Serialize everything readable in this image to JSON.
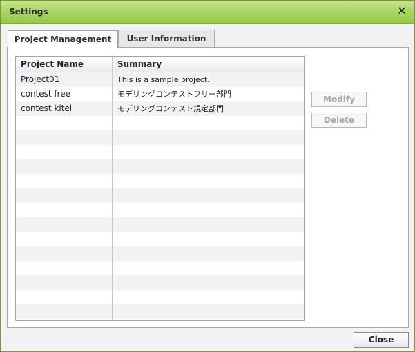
{
  "window": {
    "title": "Settings",
    "close_icon": "close-icon"
  },
  "tabs": [
    {
      "label": "Project Management",
      "active": true
    },
    {
      "label": "User Information",
      "active": false
    }
  ],
  "grid": {
    "columns": [
      "Project Name",
      "Summary"
    ],
    "rows": [
      {
        "name": "Project01",
        "summary": "This is a sample project."
      },
      {
        "name": "contest free",
        "summary": "モデリングコンテストフリー部門"
      },
      {
        "name": "contest kitei",
        "summary": "モデリングコンテスト規定部門"
      }
    ]
  },
  "actions": {
    "modify_label": "Modify",
    "delete_label": "Delete"
  },
  "footer": {
    "close_label": "Close"
  }
}
